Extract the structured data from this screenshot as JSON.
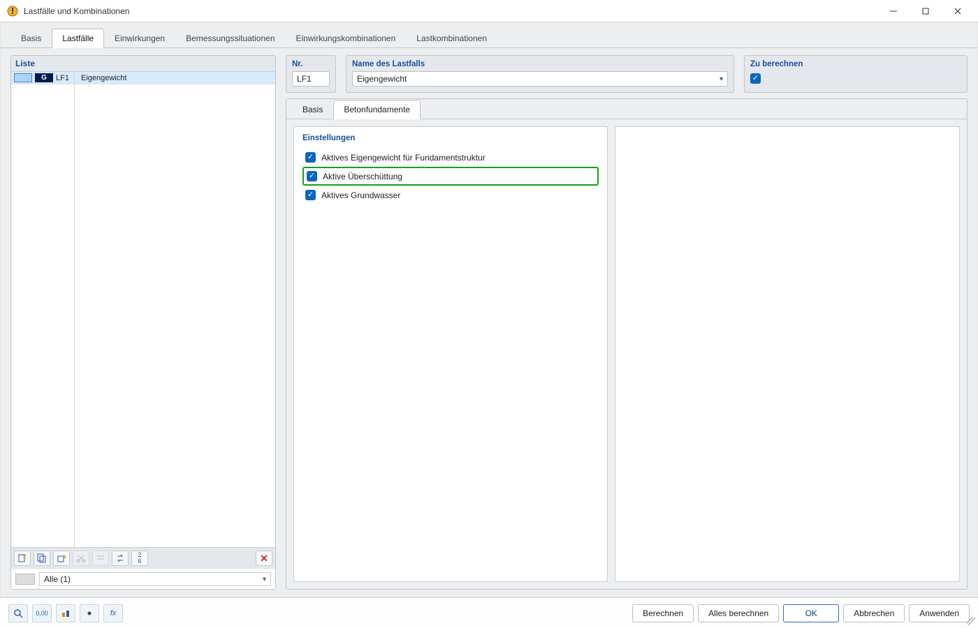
{
  "window": {
    "title": "Lastfälle und Kombinationen"
  },
  "tabs": {
    "items": [
      "Basis",
      "Lastfälle",
      "Einwirkungen",
      "Bemessungssituationen",
      "Einwirkungskombinationen",
      "Lastkombinationen"
    ],
    "active_index": 1
  },
  "left": {
    "header": "Liste",
    "row": {
      "category_letter": "G",
      "code": "LF1",
      "name": "Eigengewicht"
    },
    "filter_label": "Alle (1)"
  },
  "detail": {
    "nr_label": "Nr.",
    "nr_value": "LF1",
    "name_label": "Name des Lastfalls",
    "name_value": "Eigengewicht",
    "calc_label": "Zu berechnen",
    "calc_checked": true
  },
  "subtabs": {
    "items": [
      "Basis",
      "Betonfundamente"
    ],
    "active_index": 1
  },
  "settings": {
    "header": "Einstellungen",
    "opt_selfweight": "Aktives Eigengewicht für Fundamentstruktur",
    "opt_backfill": "Aktive Überschüttung",
    "opt_groundwater": "Aktives Grundwasser"
  },
  "footer": {
    "berechnen": "Berechnen",
    "alles_berechnen": "Alles berechnen",
    "ok": "OK",
    "abbrechen": "Abbrechen",
    "anwenden": "Anwenden"
  }
}
